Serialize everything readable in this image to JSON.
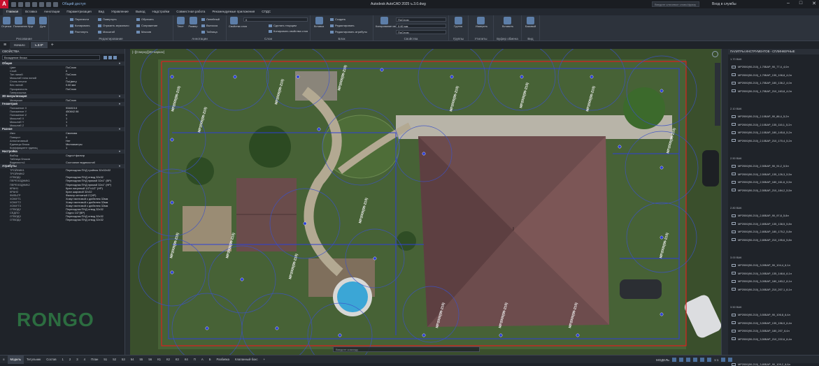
{
  "titlebar": {
    "app_letter": "A",
    "share_label": "Общий доступ",
    "doc_title": "Autodesk AutoCAD 2025   ъ.3.0.dwg",
    "search_placeholder": "Введите ключевое слово/фразу",
    "signin": "Вход в службы"
  },
  "ribbon_tabs": [
    "Главная",
    "Вставка",
    "Аннотации",
    "Параметризация",
    "Вид",
    "Управление",
    "Вывод",
    "Надстройки",
    "Совместная работа",
    "Рекомендуемые приложения",
    "СПДС"
  ],
  "ribbon": {
    "draw": {
      "title": "Рисование",
      "tools": [
        "Отрезок",
        "Полилиния",
        "Круг",
        "Дуга"
      ]
    },
    "modify": {
      "title": "Редактирование",
      "rows": [
        "Перенести",
        "Копировать",
        "Растянуть",
        "Повернуть",
        "Отразить зеркально",
        "Масштаб",
        "Обрезать",
        "Сопряжение",
        "Массив"
      ]
    },
    "annotation": {
      "title": "Аннотации",
      "tools": [
        "Текст",
        "Размер"
      ],
      "rows": [
        "Линейный",
        "Выноска",
        "Таблица"
      ]
    },
    "layers": {
      "title": "Слои",
      "tool": "Свойства слоя",
      "rows": [
        "Сделать текущим",
        "Копировать свойства слоя"
      ],
      "combo": "0"
    },
    "block": {
      "title": "Блок",
      "tool": "Вставка",
      "rows": [
        "Создать",
        "Редактировать",
        "Редактировать атрибуты"
      ]
    },
    "properties": {
      "title": "Свойства",
      "tool": "Копирование свойств",
      "color": "ПоСлою",
      "lineweight": "0.60 мм",
      "linetype": "ПоСлою"
    },
    "groups": {
      "title": "Группы",
      "tool": "Группа"
    },
    "utilities": {
      "title": "Утилиты",
      "tool": "Измерить"
    },
    "clipboard": {
      "title": "Буфер обмена",
      "tool": "Вставить"
    },
    "view": {
      "title": "Вид",
      "tool": "Базовый"
    }
  },
  "file_tabs": [
    "Начало",
    "ъ.3.0*"
  ],
  "properties": {
    "title": "СВОЙСТВА",
    "selection": "Вхождение блока",
    "sections": [
      {
        "name": "Общие",
        "rows": [
          [
            "Цвет",
            "ПоСлою"
          ],
          [
            "Слой",
            "0"
          ],
          [
            "Тип линий",
            "ПоСлою"
          ],
          [
            "Масштаб типа линий",
            "1"
          ],
          [
            "Стиль печати",
            "ПоЦвету"
          ],
          [
            "Вес линий",
            "0.60 мм"
          ],
          [
            "Прозрачность",
            "ПоСлою"
          ],
          [
            "Гиперссылка",
            ""
          ]
        ]
      },
      {
        "name": "3D визуализация",
        "rows": [
          [
            "Материал",
            "ПоСлою"
          ]
        ]
      },
      {
        "name": "Геометрия",
        "rows": [
          [
            "Положение X",
            "934815.6"
          ],
          [
            "Положение Y",
            "450842.98"
          ],
          [
            "Положение Z",
            "0"
          ],
          [
            "Масштаб X",
            "1"
          ],
          [
            "Масштаб Y",
            "1"
          ],
          [
            "Масштаб Z",
            "1"
          ]
        ]
      },
      {
        "name": "Разное",
        "rows": [
          [
            "Имя",
            "Сминова"
          ],
          [
            "Поворот",
            "0"
          ],
          [
            "Аннотативный",
            "Нет"
          ],
          [
            "Единицы блока",
            "Миллиметры"
          ],
          [
            "Коэффициент единиц",
            "1"
          ]
        ]
      },
      {
        "name": "Настройка",
        "rows": [
          [
            "Выбор",
            "Седло+фильтр"
          ],
          [
            "Таблица блоков",
            ""
          ],
          [
            "Видимость1",
            "Состояние видимости0"
          ]
        ]
      },
      {
        "name": "Атрибуты",
        "rows": [
          [
            "ТРОЙНИК1",
            "Переходник ПНД тройник 32х32х32"
          ],
          [
            "ТРОЙНИК2",
            ""
          ],
          [
            "ОТВОД1",
            "Переходник ПНД отвод 32х32"
          ],
          [
            "ПЕРЕХОДНИК1",
            "Переходник ПНД прямой 32х1\" (ВР)"
          ],
          [
            "ПЕРЕХОДНИК2",
            "Переходник ПНД прямой 32х1\" (НР)"
          ],
          [
            "КРАН1",
            "Кран латунный 1/2\"х1/2\" (НР)"
          ],
          [
            "КРАН2",
            "Кран шаровой 32х32"
          ],
          [
            "ФИЛЬТР",
            "Фильтр сетчатый 1\"(НР)"
          ],
          [
            "ХОМУТ1",
            "Хомут винтовой с дюбелем 32мм"
          ],
          [
            "ХОМУТ2",
            "Хомут винтовой с дюбелем 32мм"
          ],
          [
            "ХОМУТ3",
            "Хомут винтовой с дюбелем 32мм"
          ],
          [
            "ОТВОД2",
            "Переходник ПНД отвод 32х32"
          ],
          [
            "СЕДЛО",
            "Седло 1/2\"(ВР)"
          ],
          [
            "ОТВОД3",
            "Переходник ПНД отвод 32х32"
          ],
          [
            "ОТВОД4",
            "Переходник ПНД отвод 32х32"
          ]
        ]
      }
    ]
  },
  "viewport": {
    "label": "[–][Сверху][2D-каркас]",
    "command_placeholder": "Введите команду"
  },
  "palette": {
    "title": "ПАЛИТРЫ ИНСТРУМЕНТОВ - СПЛИНКЕРНЫЕ",
    "groups": [
      {
        "name": "1.70 ВАК",
        "items": [
          "МР2000(90-210)_1,70БАР_90_77,4_4,0л",
          "МР2000(90-210)_1,70БАР_135_108,8_4,0л",
          "МР2000(90-210)_1,70БАР_180_136,2_4,0л",
          "МР2000(90-210)_1,70БАР_210_163,8_4,0л"
        ]
      },
      {
        "name": "2.10 ВАК",
        "items": [
          "МР2000(90-210)_2,10БАР_90_86,4_5,2л",
          "МР2000(90-210)_2,10БАР_135_116,1_5,2л",
          "МР2000(90-210)_2,10БАР_180_145,8_5,2л",
          "МР2000(90-210)_2,10БАР_210_170,4_5,2л"
        ]
      },
      {
        "name": "2.50 ВАК",
        "items": [
          "МР2000(90-210)_2,50БАР_90_91,2_5,5л",
          "МР2000(90-210)_2,50БАР_135_126,3_5,5л",
          "МР2000(90-210)_2,50БАР_180_161,6_5,5л",
          "МР2000(90-210)_2,50БАР_210_184,2_5,5л"
        ]
      },
      {
        "name": "2.80 ВАК",
        "items": [
          "МР2000(90-210)_2,80БАР_90_97,8_5,8л",
          "МР2000(90-210)_2,80БАР_135_138,5_5,8л",
          "МР2000(90-210)_2,80БАР_180_175,2_5,8л",
          "МР2000(90-210)_2,80БАР_210_195,6_5,8л"
        ]
      },
      {
        "name": "3.00 ВАК",
        "items": [
          "МР2000(90-210)_3,00БАР_90_104,4_6,1л",
          "МР2000(90-210)_3,00БАР_135_148,6_6,1л",
          "МР2000(90-210)_3,00БАР_180_183,2_6,1л",
          "МР2000(90-210)_3,00БАР_210_207,1_6,1л"
        ]
      },
      {
        "name": "3.50 ВАК",
        "items": [
          "МР2000(90-210)_3,50БАР_90_106,8_6,4л",
          "МР2000(90-210)_3,50БАР_135_156,9_6,4л",
          "МР2000(90-210)_3,50БАР_180_207_6,4л",
          "МР2000(90-210)_3,50БАР_210_222,6_6,4л"
        ]
      },
      {
        "name": "3.80 ВАК",
        "items": [
          "МР2000(90-210)_3,80БАР_90_109,2_6,6л"
        ]
      }
    ]
  },
  "layout_tabs": [
    "Модель",
    "Титульник",
    "Состав",
    "1",
    "2",
    "3",
    "4",
    "План",
    "51",
    "52",
    "53",
    "54",
    "55",
    "56",
    "К1",
    "К2",
    "К3",
    "К4",
    "П",
    "А",
    "Б",
    "Разбивка",
    "Клапанный бокс"
  ],
  "status": {
    "mode": "МОДЕЛЬ",
    "scale": "1:1"
  },
  "watermark": "RONGO",
  "colors": {
    "accent": "#c8102e",
    "grass": "#3f5a2e",
    "roof": "#7a5a58",
    "pipe_blue": "#2c3fd6",
    "pipe_red": "#d82020"
  }
}
